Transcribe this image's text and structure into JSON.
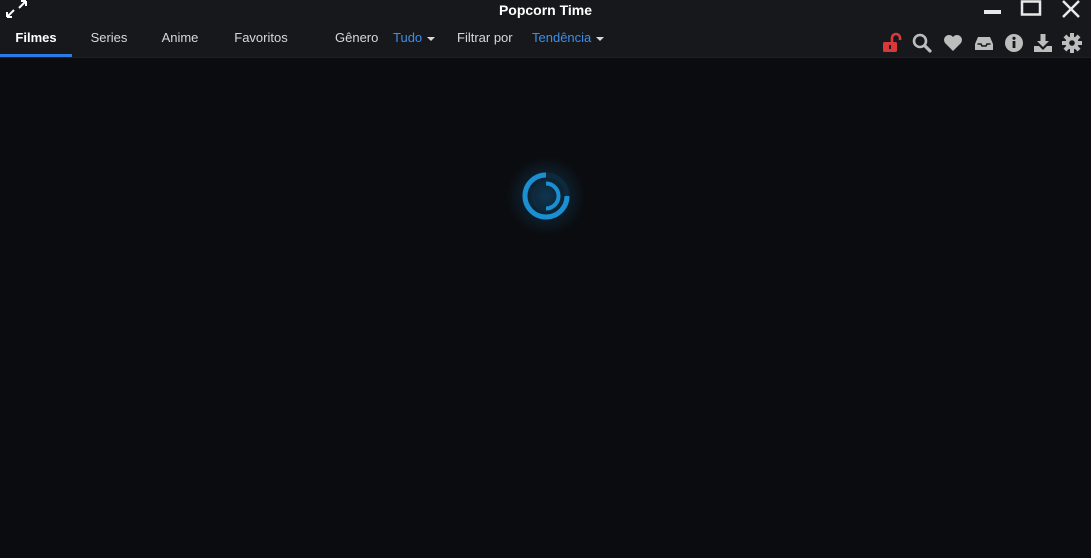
{
  "window": {
    "title": "Popcorn Time"
  },
  "nav": {
    "tabs": [
      {
        "label": "Filmes",
        "active": true
      },
      {
        "label": "Series",
        "active": false
      },
      {
        "label": "Anime",
        "active": false
      },
      {
        "label": "Favoritos",
        "active": false
      }
    ],
    "genre": {
      "label": "Gênero",
      "value": "Tudo"
    },
    "sort": {
      "label": "Filtrar por",
      "value": "Tendência"
    }
  },
  "toolbar": {
    "icons": [
      "vpn-unlocked-icon",
      "search-icon",
      "heart-icon",
      "inbox-icon",
      "info-icon",
      "download-icon",
      "gear-icon"
    ]
  },
  "colors": {
    "accent": "#2c7be5",
    "link": "#3d8ee8",
    "vpn": "#d9383a",
    "spinner": "#1b8fd1"
  },
  "content": {
    "loading": true
  }
}
